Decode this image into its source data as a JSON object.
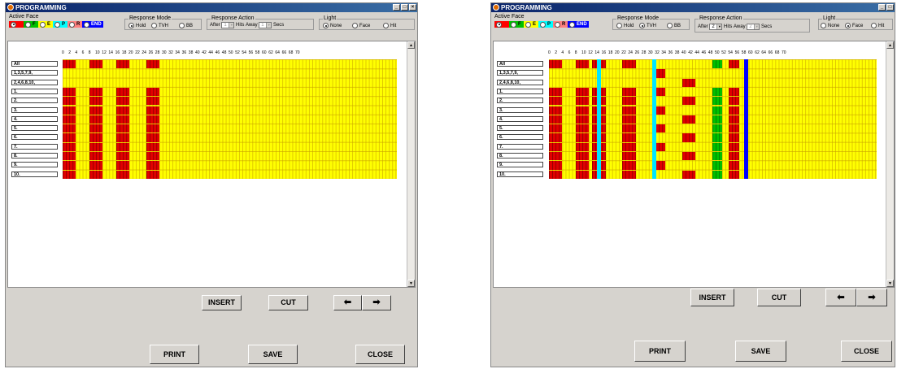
{
  "windows": [
    {
      "title": "PROGRAMMING",
      "active_face": {
        "label": "Active Face",
        "options": [
          {
            "label": "",
            "color": "#ff0000",
            "on": true
          },
          {
            "label": "F",
            "color": "#00c000"
          },
          {
            "label": "E",
            "color": "#ffff00"
          },
          {
            "label": "P",
            "color": "#00ffff"
          },
          {
            "label": "R",
            "color": "#ff8080"
          },
          {
            "label": "END",
            "color": "#0000ff"
          }
        ]
      },
      "response_mode": {
        "label": "Response Mode",
        "options": [
          {
            "label": "Hold",
            "on": true
          },
          {
            "label": "TVH",
            "on": false
          },
          {
            "label": "BB",
            "on": false
          }
        ]
      },
      "response_action": {
        "label": "Response Action",
        "after_label": "After",
        "after_value": "1",
        "hits_label": "Hits",
        "away_label": "Away",
        "away_value": "1",
        "secs_label": "Secs",
        "enabled": false
      },
      "light": {
        "label": "Light",
        "options": [
          {
            "label": "None",
            "on": true
          },
          {
            "label": "Face",
            "on": false
          },
          {
            "label": "Hit",
            "on": false
          }
        ]
      },
      "ruler": [
        "0",
        "2",
        "4",
        "6",
        "8",
        "10",
        "12",
        "14",
        "16",
        "18",
        "20",
        "22",
        "24",
        "26",
        "28",
        "30",
        "32",
        "34",
        "36",
        "38",
        "40",
        "42",
        "44",
        "46",
        "48",
        "50",
        "52",
        "54",
        "56",
        "58",
        "60",
        "62",
        "64",
        "66",
        "68",
        "70"
      ],
      "rows": [
        "All",
        "1,3,5,7,9,",
        "2,4,6,8,10,",
        "1.",
        "2.",
        "3.",
        "4.",
        "5.",
        "6.",
        "7.",
        "8.",
        "9.",
        "10."
      ],
      "buttons": {
        "insert": "INSERT",
        "cut": "CUT",
        "print": "PRINT",
        "save": "SAVE",
        "close": "CLOSE"
      }
    },
    {
      "title": "PROGRAMMING",
      "active_face": {
        "label": "Active Face",
        "options": [
          {
            "label": "",
            "color": "#ff0000",
            "on": true
          },
          {
            "label": "F",
            "color": "#00c000"
          },
          {
            "label": "E",
            "color": "#ffff00"
          },
          {
            "label": "P",
            "color": "#00ffff"
          },
          {
            "label": "R",
            "color": "#ff8080"
          },
          {
            "label": "END",
            "color": "#0000ff"
          }
        ]
      },
      "response_mode": {
        "label": "Response Mode",
        "options": [
          {
            "label": "Hold",
            "on": false
          },
          {
            "label": "TVH",
            "on": true
          },
          {
            "label": "BB",
            "on": false
          }
        ]
      },
      "response_action": {
        "label": "Response Action",
        "after_label": "After",
        "after_value": "2",
        "hits_label": "Hits",
        "away_label": "Away",
        "away_value": "2",
        "secs_label": "Secs",
        "enabled": true
      },
      "light": {
        "label": "Light",
        "options": [
          {
            "label": "None",
            "on": false
          },
          {
            "label": "Face",
            "on": true
          },
          {
            "label": "Hit",
            "on": false
          }
        ]
      },
      "ruler": [
        "0",
        "2",
        "4",
        "6",
        "8",
        "10",
        "12",
        "14",
        "16",
        "18",
        "20",
        "22",
        "24",
        "26",
        "28",
        "30",
        "32",
        "34",
        "36",
        "38",
        "40",
        "42",
        "44",
        "46",
        "48",
        "50",
        "52",
        "54",
        "56",
        "58",
        "60",
        "62",
        "64",
        "66",
        "68",
        "70"
      ],
      "rows": [
        "All",
        "1,3,5,7,9,",
        "2,4,6,8,10,",
        "1.",
        "2.",
        "3.",
        "4.",
        "5.",
        "6.",
        "7.",
        "8.",
        "9.",
        "10."
      ],
      "buttons": {
        "insert": "INSERT",
        "cut": "CUT",
        "print": "PRINT",
        "save": "SAVE",
        "close": "CLOSE"
      }
    }
  ]
}
